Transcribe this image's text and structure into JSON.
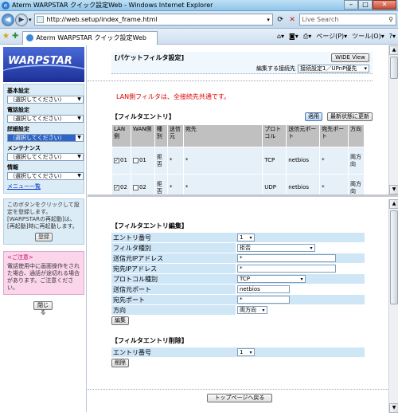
{
  "window": {
    "title": "Aterm WARPSTAR クイック設定Web - Windows Internet Explorer",
    "url": "http://web.setup/index_frame.html",
    "search_placeholder": "Live Search",
    "tab_title": "Aterm WARPSTAR クイック設定Web",
    "page_menu": "ページ(P)",
    "tools_menu": "ツール(O)"
  },
  "left": {
    "logo_text": "WARPSTAR",
    "menus": [
      {
        "label": "基本設定",
        "value": "（選択してください）"
      },
      {
        "label": "電話設定",
        "value": "（選択してください）"
      },
      {
        "label": "詳細設定",
        "value": "（選択してください）"
      },
      {
        "label": "メンテナンス",
        "value": "（選択してください）"
      },
      {
        "label": "情報",
        "value": "（選択してください）"
      }
    ],
    "menu_list_link": "メニュー一覧",
    "set_note": "このボタンをクリックして設定を登録します。[WARPSTARの再起動]は、[再起動]時に再起動します。",
    "register_button": "登録",
    "caution_title": "<ご注意>",
    "caution_text": "電話使用中に画面操作をされた場合、通話が途切れる場合があります。ご注意ください。",
    "close_button": "閉じる"
  },
  "top": {
    "title": "[パケットフィルタ設定]",
    "wide_button": "WIDE View",
    "dest_label": "編集する接続先",
    "dest_value": "接続設定1／UPnP優先",
    "note": "LAN側フィルタは、全接続先共通です。",
    "entry_title": "【フィルタエントリ】",
    "apply_button": "適用",
    "refresh_button": "最新状態に更新",
    "columns": [
      "LAN側",
      "WAN側",
      "種別",
      "送信元",
      "宛先",
      "プロトコル",
      "送信元ポート",
      "宛先ポート",
      "方向"
    ],
    "rows": [
      {
        "lan": "01",
        "wan": "01",
        "kind": "拒否",
        "src": "*",
        "dst": "*",
        "proto": "TCP",
        "sport": "netbios",
        "dport": "*",
        "dir": "両方向"
      },
      {
        "lan": "02",
        "wan": "02",
        "kind": "拒否",
        "src": "*",
        "dst": "*",
        "proto": "UDP",
        "sport": "netbios",
        "dport": "*",
        "dir": "両方向"
      }
    ]
  },
  "bottom": {
    "edit_title": "【フィルタエントリ編集】",
    "fields": {
      "entry_no_label": "エントリ番号",
      "entry_no": "1",
      "filter_type_label": "フィルタ種別",
      "filter_type": "拒否",
      "src_ip_label": "送信元IPアドレス",
      "src_ip": "*",
      "dst_ip_label": "宛先IPアドレス",
      "dst_ip": "*",
      "proto_label": "プロトコル種別",
      "proto": "TCP",
      "src_port_label": "送信元ポート",
      "src_port": "netbios",
      "dst_port_label": "宛先ポート",
      "dst_port": "*",
      "dir_label": "方向",
      "dir": "両方向"
    },
    "edit_button": "編集",
    "delete_title": "【フィルタエントリ削除】",
    "del_entry_label": "エントリ番号",
    "del_entry": "1",
    "delete_button": "削除",
    "back_button": "トップページへ戻る"
  }
}
